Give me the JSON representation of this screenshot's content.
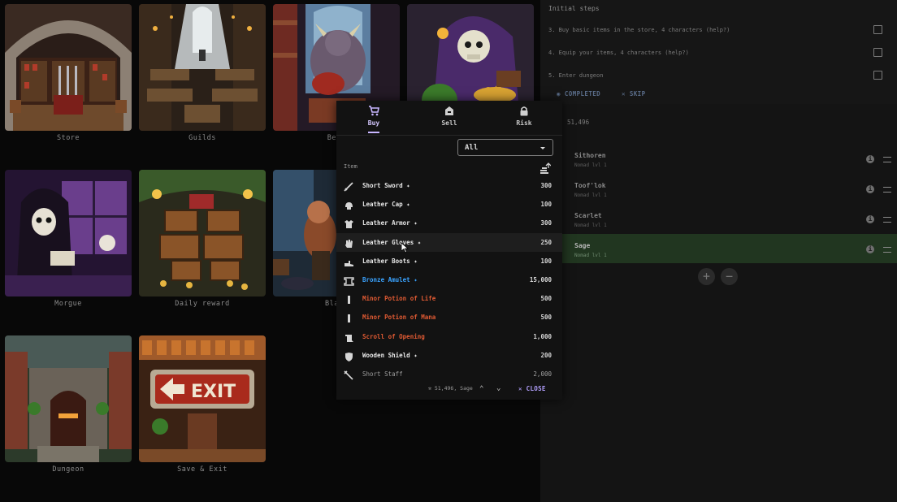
{
  "locations": [
    {
      "label": "Store"
    },
    {
      "label": "Guilds"
    },
    {
      "label": "Best"
    },
    {
      "label": ""
    },
    {
      "label": "Morgue"
    },
    {
      "label": "Daily reward"
    },
    {
      "label": "Black"
    },
    {
      "label": "Dungeon"
    },
    {
      "label": "Save & Exit"
    }
  ],
  "steps": {
    "title": "Initial steps",
    "items": [
      {
        "label": "3. Buy basic items in the store, 4 characters (help?)"
      },
      {
        "label": "4. Equip your items, 4 characters (help?)"
      },
      {
        "label": "5. Enter dungeon"
      }
    ],
    "completed_label": "COMPLETED",
    "skip_label": "SKIP"
  },
  "gold": "51,496",
  "characters": [
    {
      "name": "Sithoren",
      "class": "Nomad lvl 1",
      "selected": false
    },
    {
      "name": "Toof'lok",
      "class": "Nomad lvl 1",
      "selected": false
    },
    {
      "name": "Scarlet",
      "class": "Nomad lvl 1",
      "selected": false
    },
    {
      "name": "Sage",
      "class": "Nomad lvl 1",
      "selected": true
    }
  ],
  "add_label": "+",
  "remove_label": "−",
  "store": {
    "tabs": [
      {
        "label": "Buy",
        "icon": "cart-icon"
      },
      {
        "label": "Sell",
        "icon": "vendor-icon"
      },
      {
        "label": "Risk",
        "icon": "lock-icon"
      }
    ],
    "filter": "All",
    "column_item": "Item",
    "items": [
      {
        "name": "Short Sword ✦",
        "price": "300",
        "icon": "sword-icon",
        "style": "normal"
      },
      {
        "name": "Leather Cap ✦",
        "price": "100",
        "icon": "cap-icon",
        "style": "normal"
      },
      {
        "name": "Leather Armor ✦",
        "price": "300",
        "icon": "armor-icon",
        "style": "normal"
      },
      {
        "name": "Leather Gloves ✦",
        "price": "250",
        "icon": "glove-icon",
        "style": "hl"
      },
      {
        "name": "Leather Boots ✦",
        "price": "100",
        "icon": "boots-icon",
        "style": "normal"
      },
      {
        "name": "Bronze Amulet ✦",
        "price": "15,000",
        "icon": "amulet-icon",
        "style": "rare"
      },
      {
        "name": "Minor Potion of Life",
        "price": "500",
        "icon": "potion-icon",
        "style": "red"
      },
      {
        "name": "Minor Potion of Mana",
        "price": "500",
        "icon": "potion-icon",
        "style": "red"
      },
      {
        "name": "Scroll of Opening",
        "price": "1,000",
        "icon": "scroll-icon",
        "style": "red"
      },
      {
        "name": "Wooden Shield ✦",
        "price": "200",
        "icon": "shield-icon",
        "style": "normal"
      },
      {
        "name": "Short Staff",
        "price": "2,000",
        "icon": "staff-icon",
        "style": "dim"
      }
    ],
    "footer_gold": "51,496, Sage",
    "close_label": "CLOSE"
  }
}
